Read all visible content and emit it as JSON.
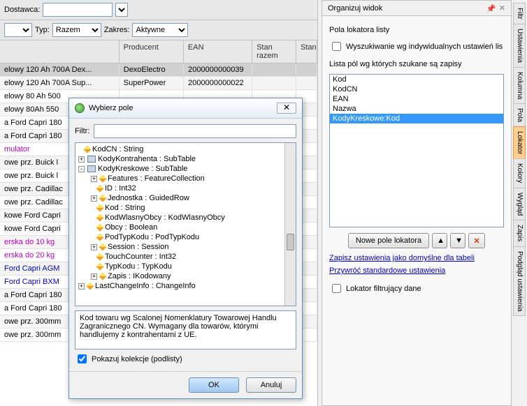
{
  "toolbar": {
    "dostawca_label": "Dostawca:",
    "typ_label": "Typ:",
    "typ_value": "Razem",
    "zakres_label": "Zakres:",
    "zakres_value": "Aktywne"
  },
  "grid": {
    "headers": {
      "producent": "Producent",
      "ean": "EAN",
      "stan_razem": "Stan razem",
      "stan": "Stan"
    },
    "rows": [
      {
        "name": "elowy 120 Ah 700A Dex...",
        "prod": "DexoElectro",
        "ean": "2000000000039",
        "cls": "sel"
      },
      {
        "name": "elowy 120 Ah 700A Sup...",
        "prod": "SuperPower",
        "ean": "2000000000022"
      },
      {
        "name": "elowy 80 Ah 500"
      },
      {
        "name": "elowy 80Ah 550"
      },
      {
        "name": "a Ford Capri 180"
      },
      {
        "name": "a Ford Capri 180"
      },
      {
        "name": "mulator",
        "cls": "magenta"
      },
      {
        "name": "owe prz. Buick l"
      },
      {
        "name": "owe prz. Buick l"
      },
      {
        "name": "owe prz. Cadillac"
      },
      {
        "name": "owe prz. Cadillac"
      },
      {
        "name": "kowe Ford Capri"
      },
      {
        "name": "kowe Ford Capri"
      },
      {
        "name": "erska do 10 kg",
        "cls": "magenta"
      },
      {
        "name": "erska do 20 kg",
        "cls": "magenta"
      },
      {
        "name": "Ford Capri AGM",
        "cls": "blue"
      },
      {
        "name": "Ford Capri BXM",
        "cls": "blue"
      },
      {
        "name": "a Ford Capri 180"
      },
      {
        "name": "a Ford Capri 180"
      },
      {
        "name": "owe prz. 300mm"
      },
      {
        "name": "owe prz. 300mm"
      }
    ]
  },
  "dialog": {
    "title": "Wybierz pole",
    "filtr_label": "Filtr:",
    "tree": [
      {
        "toggle": "",
        "ico": "prop",
        "label": "KodCN : String"
      },
      {
        "toggle": "+",
        "ico": "table",
        "label": "KodyKontrahenta : SubTable"
      },
      {
        "toggle": "-",
        "ico": "table",
        "label": "KodyKreskowe : SubTable",
        "children": [
          {
            "toggle": "+",
            "ico": "prop",
            "label": "Features : FeatureCollection"
          },
          {
            "toggle": "",
            "ico": "prop",
            "label": "ID : Int32"
          },
          {
            "toggle": "+",
            "ico": "prop",
            "label": "Jednostka : GuidedRow"
          },
          {
            "toggle": "",
            "ico": "prop",
            "label": "Kod : String"
          },
          {
            "toggle": "",
            "ico": "prop",
            "label": "KodWlasnyObcy : KodWlasnyObcy"
          },
          {
            "toggle": "",
            "ico": "prop",
            "label": "Obcy : Boolean"
          },
          {
            "toggle": "",
            "ico": "prop",
            "label": "PodTypKodu : PodTypKodu"
          },
          {
            "toggle": "+",
            "ico": "prop",
            "label": "Session : Session"
          },
          {
            "toggle": "",
            "ico": "prop",
            "label": "TouchCounter : Int32"
          },
          {
            "toggle": "",
            "ico": "prop",
            "label": "TypKodu : TypKodu"
          },
          {
            "toggle": "+",
            "ico": "prop",
            "label": "Zapis : IKodowany"
          }
        ]
      },
      {
        "toggle": "+",
        "ico": "prop",
        "label": "LastChangeInfo : ChangeInfo"
      }
    ],
    "description": "Kod towaru wg Scalonej Nomenklatury Towarowej Handlu Zagranicznego CN. Wymagany dla towarów, którymi handlujemy z kontrahentami z UE.",
    "show_collections_label": "Pokazuj kolekcje (podlisty)",
    "show_collections_checked": true,
    "ok": "OK",
    "cancel": "Anuluj"
  },
  "right": {
    "title": "Organizuj widok",
    "locator_group": "Pola lokatora listy",
    "search_individual": "Wyszukiwanie wg indywidualnych ustawień lis",
    "list_label": "Lista pól wg których szukane są zapisy",
    "items": [
      "Kod",
      "KodCN",
      "EAN",
      "Nazwa",
      "KodyKreskowe:Kod"
    ],
    "selected_index": 4,
    "new_field_btn": "Nowe pole lokatora",
    "save_link": "Zapisz ustawienia jako domyślne dla tabeli",
    "restore_link": "Przywróć standardowe ustawienia",
    "filter_lokator": "Lokator filtrujący dane"
  },
  "side_tabs": [
    "Filtr",
    "Ustawienia",
    "Kolumna",
    "Pola",
    "Lokator",
    "Kolory",
    "Wygląd",
    "Zapis",
    "Podgląd ustawienia"
  ],
  "side_tabs_active": 4
}
